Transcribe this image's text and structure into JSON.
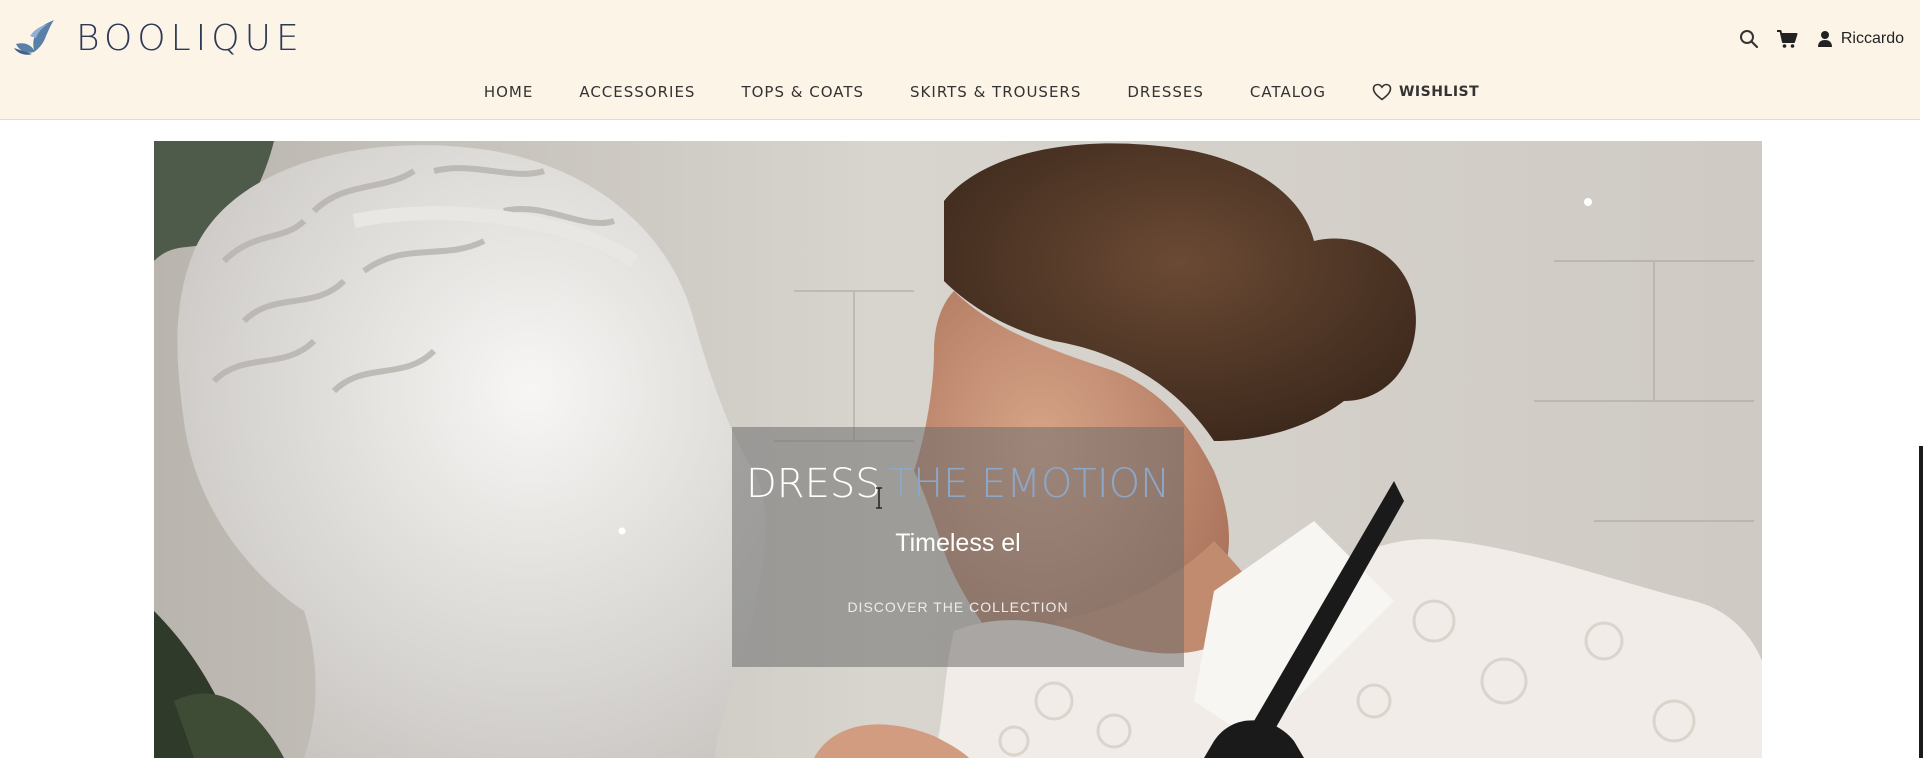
{
  "brand": {
    "name": "BOOLIQUE",
    "logo_icon": "bird-logo-icon",
    "accent_color": "#2d3a55",
    "header_bg": "#fdf4e8"
  },
  "header": {
    "tools": [
      {
        "icon": "search-icon"
      },
      {
        "icon": "cart-icon"
      }
    ],
    "account": {
      "icon": "user-icon",
      "name": "Riccardo"
    }
  },
  "nav": {
    "items": [
      {
        "label": "HOME"
      },
      {
        "label": "ACCESSORIES"
      },
      {
        "label": "TOPS & COATS"
      },
      {
        "label": "SKIRTS & TROUSERS"
      },
      {
        "label": "DRESSES"
      },
      {
        "label": "CATALOG"
      }
    ],
    "wishlist": {
      "icon": "heart-icon",
      "label": "WISHLIST"
    }
  },
  "hero": {
    "title_part1": "DRESS",
    "title_part2": "THE EMOTION",
    "title_part2_color": "#8da7c7",
    "subtitle": "Timeless el",
    "cta": "DISCOVER THE COLLECTION"
  }
}
